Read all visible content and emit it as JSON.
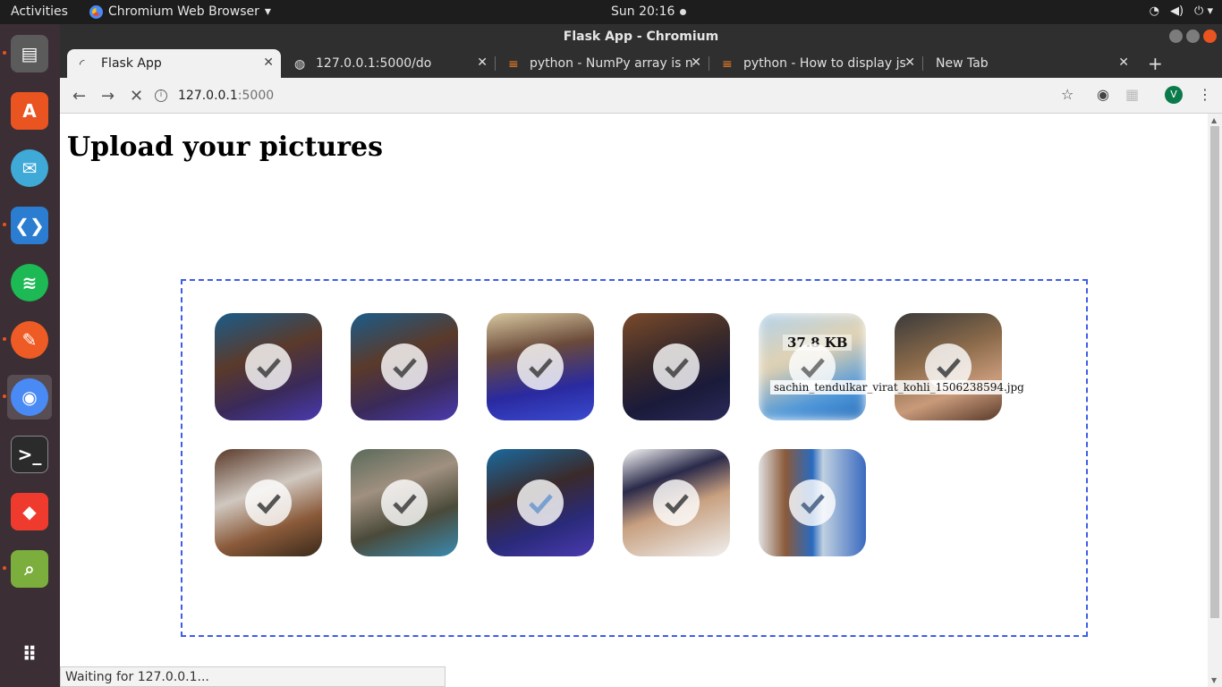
{
  "topbar": {
    "activities": "Activities",
    "app_name": "Chromium Web Browser",
    "clock": "Sun 20:16"
  },
  "dock": {
    "items": [
      {
        "name": "files",
        "color": "#5b5b5b"
      },
      {
        "name": "software-center",
        "color": "#e95420"
      },
      {
        "name": "mail",
        "color": "#3fa9d8"
      },
      {
        "name": "vscode",
        "color": "#2a7dd1"
      },
      {
        "name": "spotify",
        "color": "#1db954"
      },
      {
        "name": "postman",
        "color": "#ef5b25"
      },
      {
        "name": "chromium",
        "color": "#4a8af4"
      },
      {
        "name": "terminal",
        "color": "#2b2b2b"
      },
      {
        "name": "anydesk",
        "color": "#ef3b2d"
      },
      {
        "name": "image-viewer",
        "color": "#7cae3d"
      }
    ]
  },
  "window": {
    "title": "Flask App - Chromium"
  },
  "tabs": [
    {
      "title": "Flask App",
      "active": true
    },
    {
      "title": "127.0.0.1:5000/do",
      "active": false
    },
    {
      "title": "python - NumPy array is n",
      "active": false
    },
    {
      "title": "python - How to display js",
      "active": false
    },
    {
      "title": "New Tab",
      "active": false
    }
  ],
  "toolbar": {
    "url_host": "127.0.0.1",
    "url_port": ":5000",
    "avatar_letter": "V"
  },
  "page": {
    "title": "Upload your pictures",
    "hover_size": "37.8 KB",
    "hover_filename": "sachin_tendulkar_virat_kohli_1506238594.jpg",
    "status": "Waiting for 127.0.0.1..."
  },
  "colors": {
    "dropzone_border": "#3e5ee8"
  }
}
